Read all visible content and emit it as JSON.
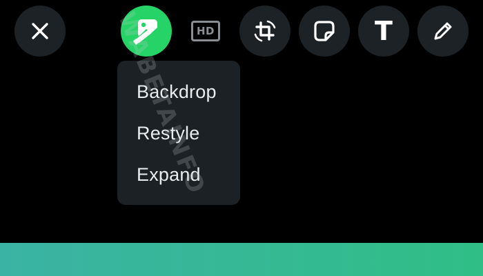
{
  "toolbar": {
    "close": {
      "icon": "close-icon"
    },
    "ai_edit": {
      "icon": "ai-image-edit-icon",
      "accent": "#25d366"
    },
    "hd": {
      "icon": "hd-quality-icon",
      "label": "HD"
    },
    "crop_rotate": {
      "icon": "crop-rotate-icon"
    },
    "sticker": {
      "icon": "sticker-icon"
    },
    "text": {
      "icon": "text-icon",
      "glyph": "T"
    },
    "draw": {
      "icon": "pencil-icon"
    }
  },
  "menu": {
    "items": [
      {
        "label": "Backdrop"
      },
      {
        "label": "Restyle"
      },
      {
        "label": "Expand"
      }
    ]
  },
  "watermark": {
    "text": "WABETAINFO"
  },
  "colors": {
    "background": "#000000",
    "button_bg": "#1d2226",
    "menu_bg": "#1c2125",
    "accent_green": "#25d366",
    "strip_start": "#3bb3a4",
    "strip_end": "#30be86"
  }
}
